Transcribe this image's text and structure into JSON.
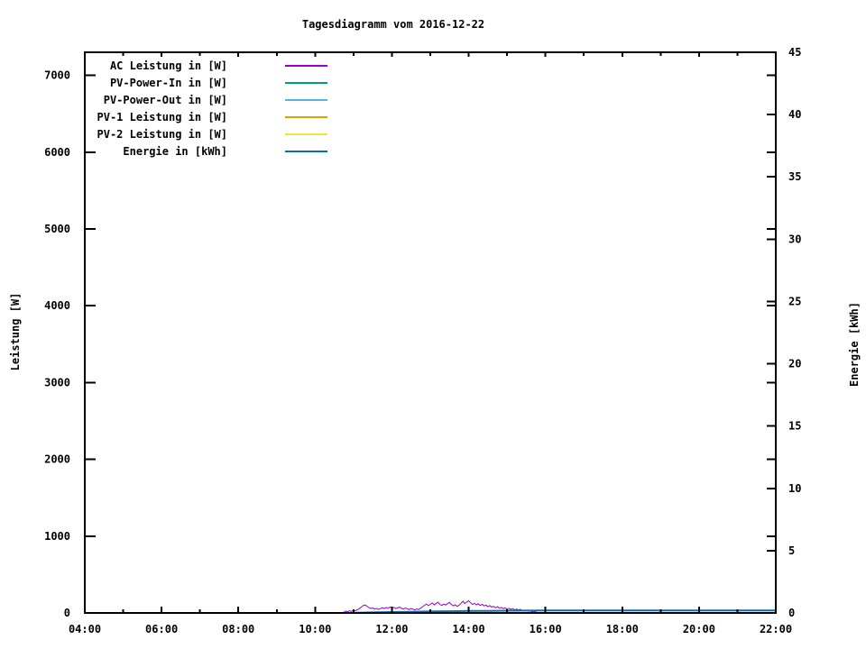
{
  "chart_data": {
    "type": "line",
    "title": "Tagesdiagramm vom 2016-12-22",
    "x_range": [
      4,
      22
    ],
    "x_ticks": {
      "hours": [
        4,
        6,
        8,
        10,
        12,
        14,
        16,
        18,
        20,
        22
      ],
      "labels": [
        "04:00",
        "06:00",
        "08:00",
        "10:00",
        "12:00",
        "14:00",
        "16:00",
        "18:00",
        "20:00",
        "22:00"
      ],
      "minor_hours": [
        5,
        7,
        9,
        11,
        13,
        15,
        17,
        19,
        21
      ]
    },
    "y1_axis": {
      "label": "Leistung [W]",
      "range": [
        0,
        7300
      ],
      "ticks": [
        0,
        1000,
        2000,
        3000,
        4000,
        5000,
        6000,
        7000
      ]
    },
    "y2_axis": {
      "label": "Energie [kWh]",
      "range": [
        0,
        45
      ],
      "ticks": [
        0,
        5,
        10,
        15,
        20,
        25,
        30,
        35,
        40,
        45
      ]
    },
    "grid": "off",
    "legend_position": "top-left-inside",
    "series": [
      {
        "name": "AC Leistung in [W]",
        "axis": "y1",
        "color": "#9400d3",
        "width": 1,
        "x_start": 10.7,
        "x_step": 0.05,
        "y": [
          3,
          10,
          22,
          16,
          28,
          20,
          34,
          28,
          42,
          55,
          75,
          95,
          104,
          88,
          70,
          58,
          66,
          50,
          60,
          46,
          56,
          68,
          58,
          72,
          62,
          76,
          64,
          72,
          56,
          66,
          76,
          60,
          50,
          64,
          54,
          44,
          58,
          48,
          40,
          52,
          46,
          62,
          82,
          100,
          116,
          96,
          112,
          130,
          106,
          122,
          140,
          112,
          96,
          116,
          102,
          122,
          136,
          110,
          92,
          106,
          86,
          102,
          126,
          152,
          122,
          142,
          160,
          132,
          112,
          126,
          106,
          120,
          96,
          112,
          92,
          102,
          82,
          96,
          76,
          86,
          66,
          82,
          62,
          72,
          56,
          66,
          50,
          60,
          46,
          56,
          40,
          50,
          36,
          46,
          30,
          26,
          32,
          22,
          26,
          16,
          20,
          10,
          6
        ]
      },
      {
        "name": "PV-Power-In in [W]",
        "axis": "y1",
        "color": "#009e73",
        "width": 1,
        "x": [
          10.7,
          15.8
        ],
        "y": [
          0,
          0
        ]
      },
      {
        "name": "PV-Power-Out in [W]",
        "axis": "y1",
        "color": "#56b4e9",
        "width": 1,
        "x": [
          10.7,
          15.8
        ],
        "y": [
          0,
          0
        ]
      },
      {
        "name": "PV-1 Leistung in [W]",
        "axis": "y1",
        "color": "#e69f00",
        "width": 1,
        "x": [
          10.7,
          15.8
        ],
        "y": [
          0,
          0
        ]
      },
      {
        "name": "PV-2 Leistung in [W]",
        "axis": "y1",
        "color": "#f0e442",
        "width": 1,
        "x": [
          10.7,
          15.8
        ],
        "y": [
          0,
          0
        ]
      },
      {
        "name": "Energie in [kWh]",
        "axis": "y2",
        "color": "#0072b2",
        "width": 2,
        "x": [
          11.0,
          11.5,
          12.0,
          12.5,
          13.0,
          13.5,
          14.0,
          14.5,
          15.0,
          15.5,
          16.0,
          22.0
        ],
        "y": [
          0.01,
          0.04,
          0.07,
          0.09,
          0.12,
          0.14,
          0.16,
          0.17,
          0.18,
          0.19,
          0.2,
          0.2
        ]
      }
    ]
  },
  "legend": {
    "entries": [
      {
        "label": "AC Leistung in [W]",
        "color": "#9400d3"
      },
      {
        "label": "PV-Power-In in [W]",
        "color": "#009e73"
      },
      {
        "label": "PV-Power-Out in [W]",
        "color": "#56b4e9"
      },
      {
        "label": "PV-1 Leistung in [W]",
        "color": "#e69f00"
      },
      {
        "label": "PV-2 Leistung in [W]",
        "color": "#f0e442"
      },
      {
        "label": "Energie in [kWh]",
        "color": "#0072b2"
      }
    ]
  },
  "colors": {
    "background": "#ffffff",
    "axis": "#000000"
  }
}
